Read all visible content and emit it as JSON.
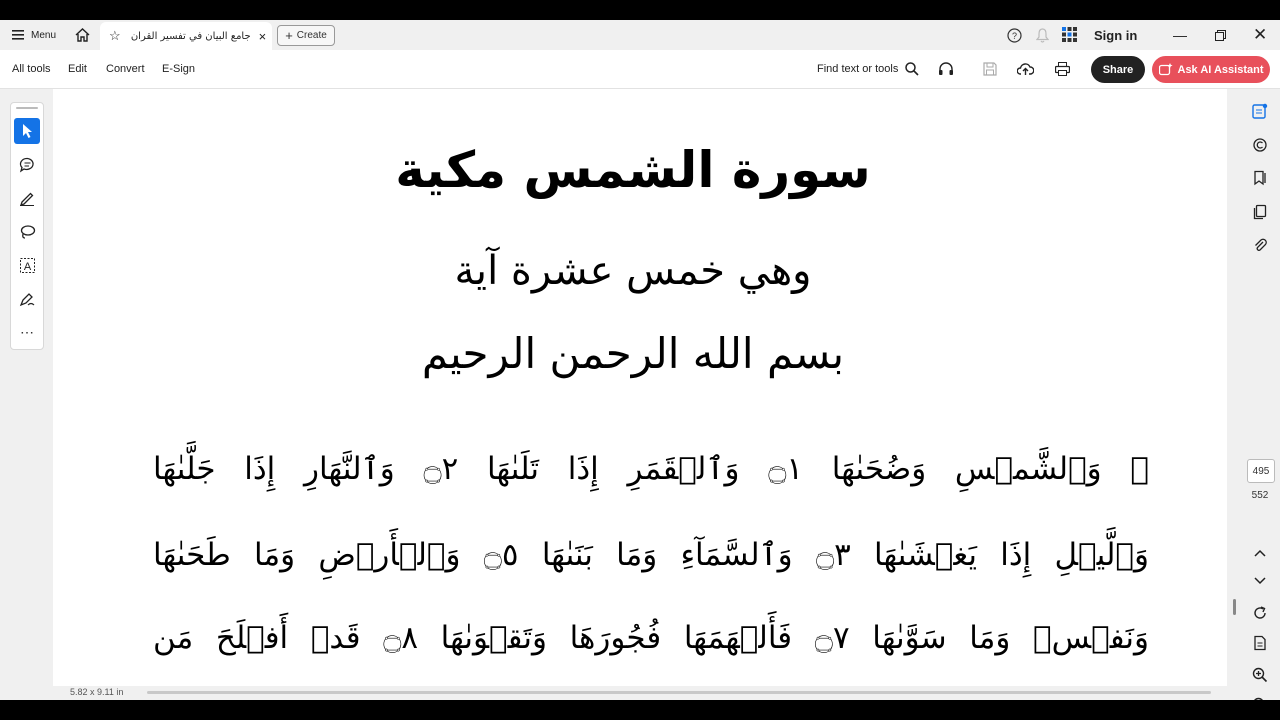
{
  "titlebar": {
    "menu_label": "Menu",
    "tab_title": "جامع البيان في تفسير القرآن -...",
    "create_label": "Create",
    "sign_in_label": "Sign in"
  },
  "toolbar": {
    "menu_items": [
      "All tools",
      "Edit",
      "Convert",
      "E-Sign"
    ],
    "find_label": "Find text or tools",
    "share_label": "Share",
    "ai_label": "Ask AI Assistant"
  },
  "document": {
    "surah_title": "سورة الشمس مكية",
    "ayah_count": "وهي خمس عشرة آية",
    "basmala": "بسم الله الرحمن الرحيم",
    "verse_lines": [
      "﴿ وَٱلشَّمۡسِ وَضُحَىٰهَا ۝١ وَٱلۡقَمَرِ إِذَا تَلَىٰهَا ۝٢ وَٱلنَّهَارِ إِذَا جَلَّىٰهَا",
      "وَٱلَّيۡلِ إِذَا يَغۡشَىٰهَا ۝٣ وَٱلسَّمَآءِ وَمَا بَنَىٰهَا ۝٥ وَٱلۡأَرۡضِ وَمَا طَحَىٰهَا",
      "وَنَفۡسٖ وَمَا سَوَّىٰهَا ۝٧ فَأَلۡهَمَهَا فُجُورَهَا وَتَقۡوَىٰهَا ۝٨ قَدۡ أَفۡلَحَ مَن"
    ]
  },
  "navigation": {
    "current_page": "495",
    "total_pages": "552"
  },
  "status": {
    "page_size": "5.82 x 9.11 in"
  },
  "colors": {
    "accent": "#1473e6",
    "ai_button": "#e8505b",
    "share_button": "#222222"
  }
}
